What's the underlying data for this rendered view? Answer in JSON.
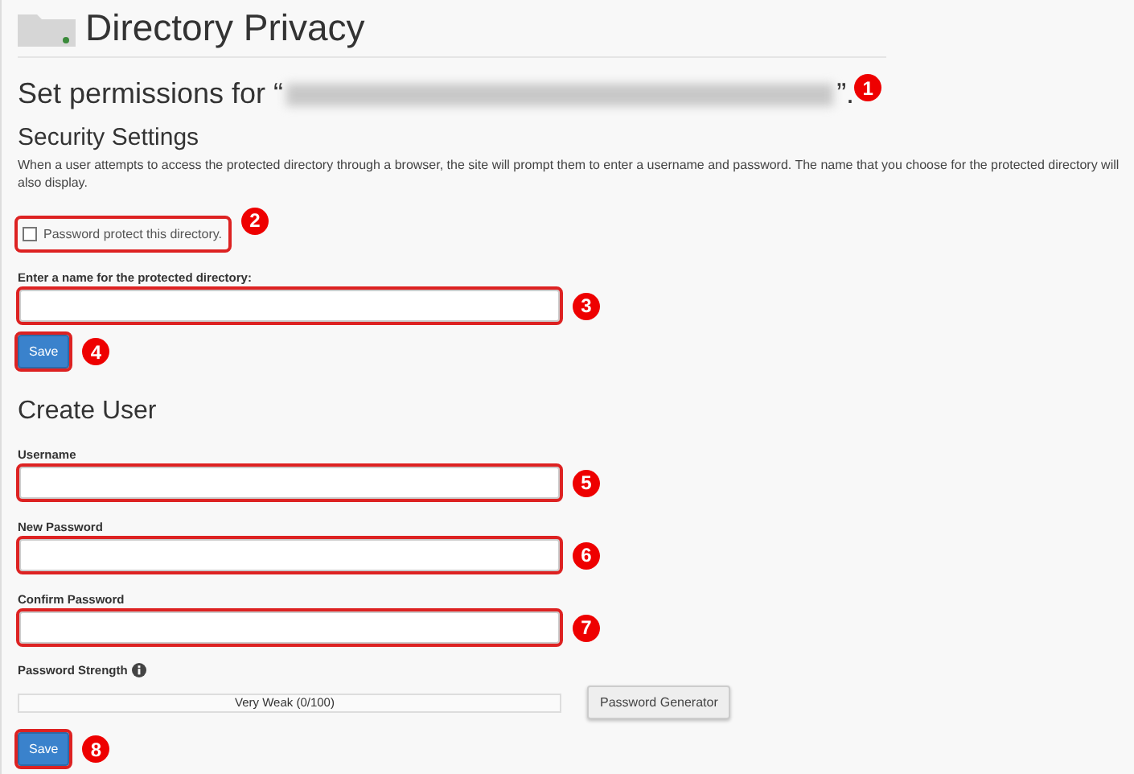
{
  "page": {
    "title": "Directory Privacy"
  },
  "permissions": {
    "prefix": "Set permissions for “",
    "path_redacted": true,
    "suffix": "”.",
    "callout": "1"
  },
  "security": {
    "heading": "Security Settings",
    "description": "When a user attempts to access the protected directory through a browser, the site will prompt them to enter a username and password. The name that you choose for the protected directory will also display.",
    "checkbox": {
      "label": "Password protect this directory.",
      "checked": false,
      "callout": "2"
    },
    "name_field": {
      "label": "Enter a name for the protected directory:",
      "callout": "3"
    },
    "save": {
      "label": "Save",
      "callout": "4"
    }
  },
  "create_user": {
    "heading": "Create User",
    "fields": [
      {
        "label": "Username",
        "callout": "5"
      },
      {
        "label": "New Password",
        "callout": "6"
      },
      {
        "label": "Confirm Password",
        "callout": "7"
      }
    ],
    "strength": {
      "label": "Password Strength",
      "level": 0,
      "reading": "Very Weak (0/100)"
    },
    "generator": {
      "label": "Password Generator"
    },
    "save": {
      "label": "Save",
      "callout": "8"
    }
  }
}
